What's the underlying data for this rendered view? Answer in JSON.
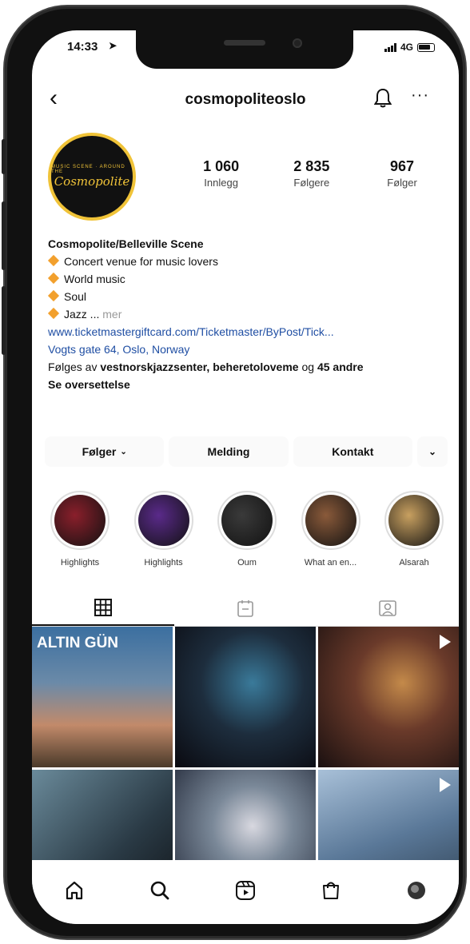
{
  "status": {
    "time": "14:33",
    "network": "4G"
  },
  "header": {
    "username": "cosmopoliteoslo",
    "more_label": "···"
  },
  "profile": {
    "avatar_text": "Cosmopolite",
    "avatar_ring_text": "MUSIC SCENE · AROUND THE",
    "stats": [
      {
        "value": "1 060",
        "label": "Innlegg"
      },
      {
        "value": "2 835",
        "label": "Følgere"
      },
      {
        "value": "967",
        "label": "Følger"
      }
    ]
  },
  "bio": {
    "name": "Cosmopolite/Belleville Scene",
    "lines": [
      "Concert venue for music lovers",
      "World music",
      "Soul",
      "Jazz"
    ],
    "more": "mer",
    "link": "www.ticketmastergiftcard.com/Ticketmaster/ByPost/Tick...",
    "address": "Vogts gate 64, Oslo, Norway",
    "followed_prefix": "Følges av ",
    "followed_names": "vestnorskjazzsenter, beheretoloveme",
    "followed_and": " og ",
    "followed_count": "45 andre",
    "translate": "Se oversettelse"
  },
  "actions": {
    "follow": "Følger",
    "message": "Melding",
    "contact": "Kontakt"
  },
  "highlights": [
    {
      "label": "Highlights",
      "color": "#8a1f2b"
    },
    {
      "label": "Highlights",
      "color": "#5a2a8a"
    },
    {
      "label": "Oum",
      "color": "#3a3a3a"
    },
    {
      "label": "What an en...",
      "color": "#8a5a3a"
    },
    {
      "label": "Alsarah",
      "color": "#c8a060"
    }
  ],
  "grid": {
    "posts": [
      {
        "title": "ALTIN GÜN",
        "video": false,
        "bg": "linear-gradient(180deg,#3b6fa0 0%,#6b8aa8 40%,#c28a6a 70%,#4a3a2a 100%)"
      },
      {
        "title": "",
        "video": false,
        "bg": "radial-gradient(circle at 55% 40%,#3a7a9a 0%,#1d2d3d 45%,#0a0a10 100%)"
      },
      {
        "title": "",
        "video": true,
        "bg": "radial-gradient(circle at 60% 40%,#c48a4a 0%,#6a3a2a 40%,#1a1010 100%)"
      },
      {
        "title": "",
        "video": false,
        "bg": "linear-gradient(135deg,#6a8a9a 0%,#2a3a45 60%,#101418 100%)"
      },
      {
        "title": "",
        "video": false,
        "bg": "radial-gradient(circle at 55% 40%,#d8d8e0 0%,#7a8898 35%,#1a2030 100%)"
      },
      {
        "title": "",
        "video": true,
        "bg": "linear-gradient(160deg,#a8c0d8 0%,#5a7898 50%,#2a3a4a 100%)"
      }
    ]
  },
  "colors": {
    "accent": "#f2a02d",
    "link": "#1f4ea3"
  }
}
